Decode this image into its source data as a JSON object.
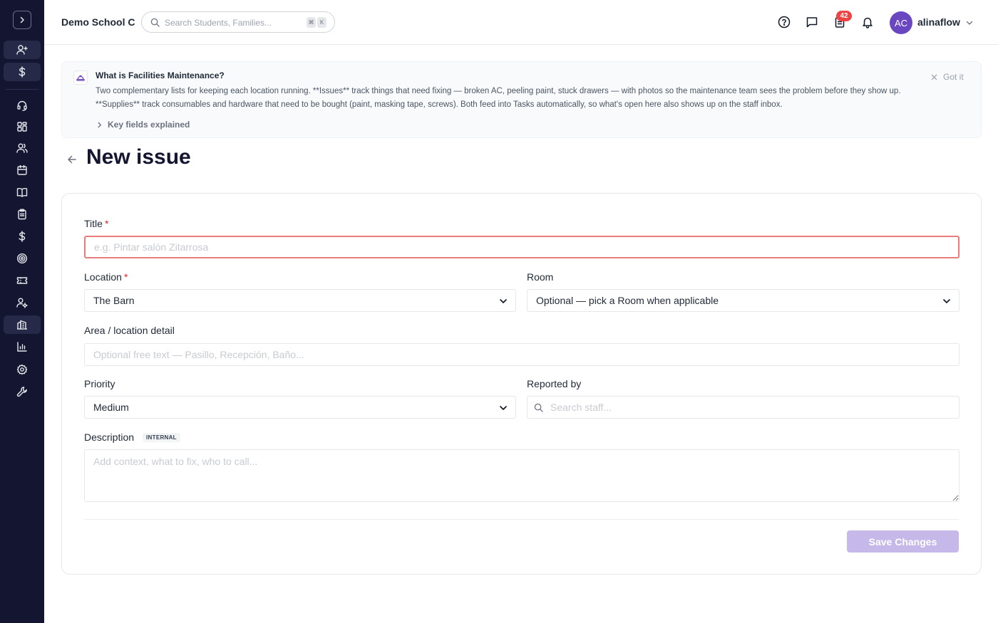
{
  "header": {
    "school_name": "Demo School C",
    "search_placeholder": "Search Students, Families...",
    "search_kbd": [
      "⌘",
      "K"
    ],
    "task_badge": "42",
    "avatar_initials": "AC",
    "username": "alinaflow"
  },
  "sidebar": {
    "items": [
      "add-user",
      "dollar",
      "headset",
      "dashboard",
      "users",
      "calendar",
      "book",
      "clipboard",
      "dollar",
      "target",
      "ticket",
      "user-settings",
      "building",
      "chart",
      "gear",
      "wrench"
    ]
  },
  "banner": {
    "title": "What is Facilities Maintenance?",
    "body": "Two complementary lists for keeping each location running. **Issues** track things that need fixing — broken AC, peeling paint, stuck drawers — with photos so the maintenance team sees the problem before they show up. **Supplies** track consumables and hardware that need to be bought (paint, masking tape, screws). Both feed into Tasks automatically, so what's open here also shows up on the staff inbox.",
    "link": "Key fields explained",
    "dismiss": "Got it"
  },
  "page": {
    "title": "New issue"
  },
  "form": {
    "title_label": "Title",
    "title_placeholder": "e.g. Pintar salón Zitarrosa",
    "location_label": "Location",
    "location_value": "The Barn",
    "room_label": "Room",
    "room_value": "Optional — pick a Room when applicable",
    "area_label": "Area / location detail",
    "area_placeholder": "Optional free text — Pasillo, Recepción, Baño...",
    "priority_label": "Priority",
    "priority_value": "Medium",
    "reported_label": "Reported by",
    "reported_placeholder": "Search staff...",
    "description_label": "Description",
    "description_tag": "INTERNAL",
    "description_placeholder": "Add context, what to fix, who to call...",
    "required_mark": "*",
    "save_label": "Save Changes"
  },
  "colors": {
    "sidebar_bg": "#141631",
    "accent": "#6b46c1",
    "save_disabled": "#c6b8e8",
    "error_border": "#e87c7c",
    "badge": "#ef4444"
  }
}
